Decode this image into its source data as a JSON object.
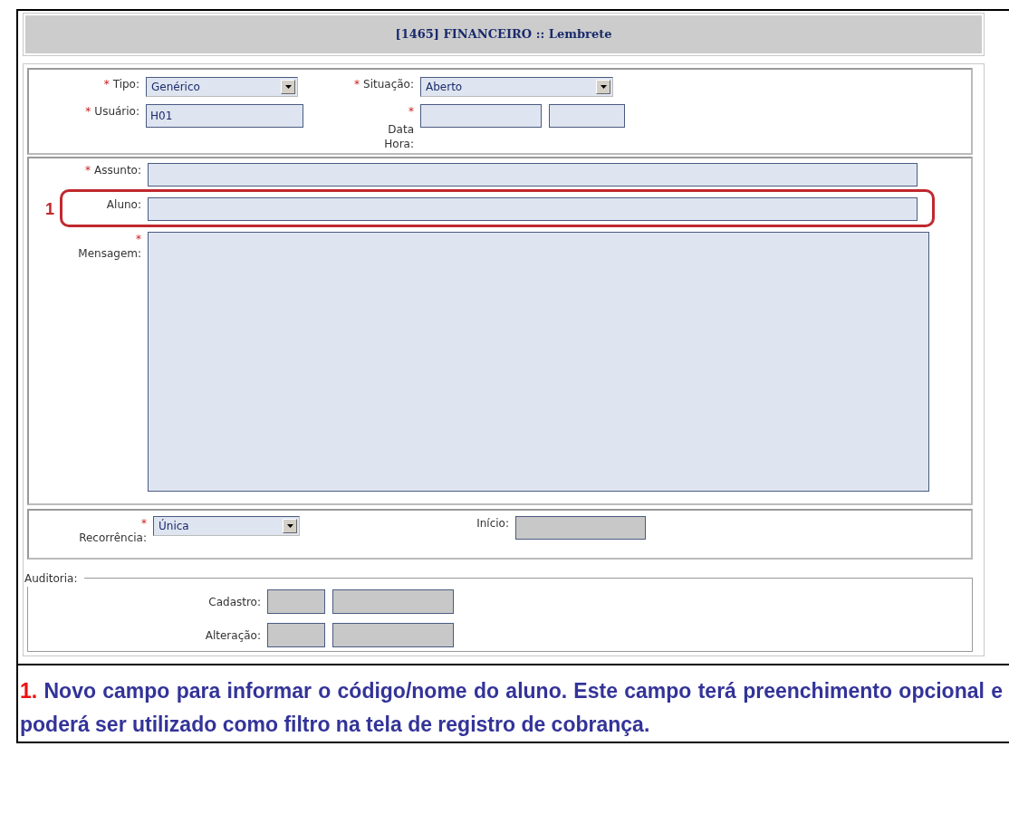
{
  "header": {
    "title": "[1465] FINANCEIRO :: Lembrete"
  },
  "section_1": [
    {
      "label": "Tipo:",
      "mark": "*",
      "kind": "select",
      "value": "Genérico",
      "disabled": false
    },
    {
      "label": "Situação:",
      "mark": "*",
      "kind": "select",
      "value": "Aberto",
      "disabled": false
    },
    {
      "label": "Usuário:",
      "mark": "*",
      "kind": "input",
      "value": "H01",
      "disabled": false
    },
    {
      "label": "Data Hora:",
      "mark": "*",
      "kind": "input_pair",
      "disabled": false
    }
  ],
  "section_2": [
    {
      "label": "Assunto:",
      "mark": "*",
      "kind": "input",
      "disabled": false,
      "highlighted": false
    },
    {
      "label": "Aluno:",
      "kind": "input",
      "disabled": false,
      "highlighted": true,
      "callout": "1"
    },
    {
      "label": "Mensagem:",
      "mark": "*",
      "kind": "textarea",
      "disabled": false,
      "highlighted": false
    }
  ],
  "section_3": [
    {
      "label": "Recorrência:",
      "mark": "*",
      "kind": "select",
      "value": "Única",
      "disabled": false
    },
    {
      "label": "Início:",
      "kind": "input",
      "disabled": true
    }
  ],
  "audit": {
    "legend": "Auditoria:",
    "rows": [
      {
        "label": "Cadastro:",
        "disabled": true
      },
      {
        "label": "Alteração:",
        "disabled": true
      }
    ]
  },
  "note": {
    "number": "1.",
    "text": "Novo campo para informar o código/nome do aluno. Este campo terá preenchimento opcional e poderá ser utilizado como filtro na tela de registro de cobrança."
  }
}
